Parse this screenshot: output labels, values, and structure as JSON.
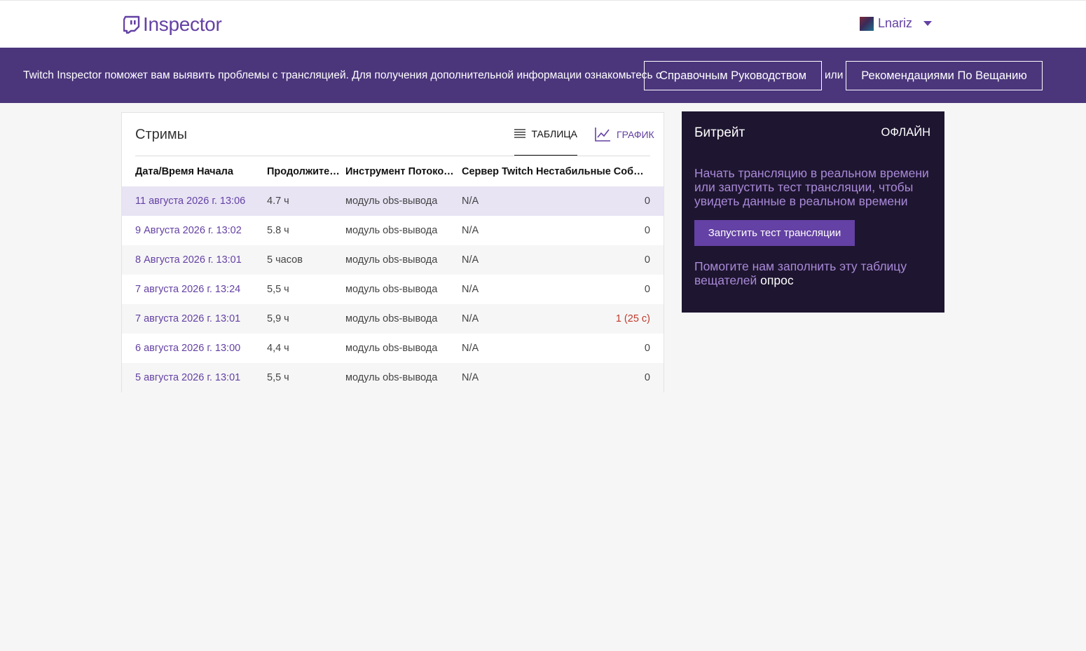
{
  "header": {
    "logo_text": "Inspector",
    "user": {
      "name": "Lnariz"
    }
  },
  "banner": {
    "text": "Twitch Inspector поможет вам выявить проблемы с трансляцией. Для получения дополнительной информации ознакомьтесь с",
    "guide_button": "Справочным Руководством",
    "or_text": "или",
    "recommendations_button": "Рекомендациями По Вещанию"
  },
  "streams": {
    "title": "Стримы",
    "view_tabs": {
      "table": "ТАБЛИЦА",
      "chart": "ГРАФИК"
    },
    "columns": [
      "Дата/Время Начала",
      "Продолжительность",
      "Инструмент Потоковой Передачи",
      "Сервер Twitch",
      "Нестабильные События"
    ],
    "rows": [
      {
        "start": "11 августа 2026 г. 13:06",
        "duration": "4.7 ч",
        "tool": "модуль obs-вывода",
        "server": "N/A",
        "events": "0",
        "selected": true
      },
      {
        "start": "9 Августа 2026 г. 13:02",
        "duration": "5.8 ч",
        "tool": "модуль obs-вывода",
        "server": "N/A",
        "events": "0"
      },
      {
        "start": "8 Августа 2026 г. 13:01",
        "duration": "5 часов",
        "tool": "модуль obs-вывода",
        "server": "N/A",
        "events": "0"
      },
      {
        "start": "7 августа 2026 г. 13:24",
        "duration": "5,5 ч",
        "tool": "модуль obs-вывода",
        "server": "N/A",
        "events": "0"
      },
      {
        "start": "7 августа 2026 г. 13:01",
        "duration": "5,9 ч",
        "tool": "модуль obs-вывода",
        "server": "N/A",
        "events": "1 (25 с)"
      },
      {
        "start": "6 августа 2026 г. 13:00",
        "duration": "4,4 ч",
        "tool": "модуль obs-вывода",
        "server": "N/A",
        "events": "0"
      },
      {
        "start": "5 августа 2026 г. 13:01",
        "duration": "5,5 ч",
        "tool": "модуль obs-вывода",
        "server": "N/A",
        "events": "0"
      }
    ]
  },
  "bitrate_panel": {
    "title": "Битрейт",
    "status": "ОФЛАЙН",
    "message": "Начать трансляцию в реальном времени или запустить тест трансляции, чтобы увидеть данные в реальном времени",
    "test_button": "Запустить тест трансляции",
    "survey_text": "Помогите нам заполнить эту таблицу вещателей",
    "survey_link": "опрос"
  },
  "colors": {
    "brand": "#6441a4",
    "banner_bg": "#4b367c",
    "panel_bg": "#1e1530",
    "selected_row": "#e8e4f4",
    "error": "#c0392b"
  }
}
